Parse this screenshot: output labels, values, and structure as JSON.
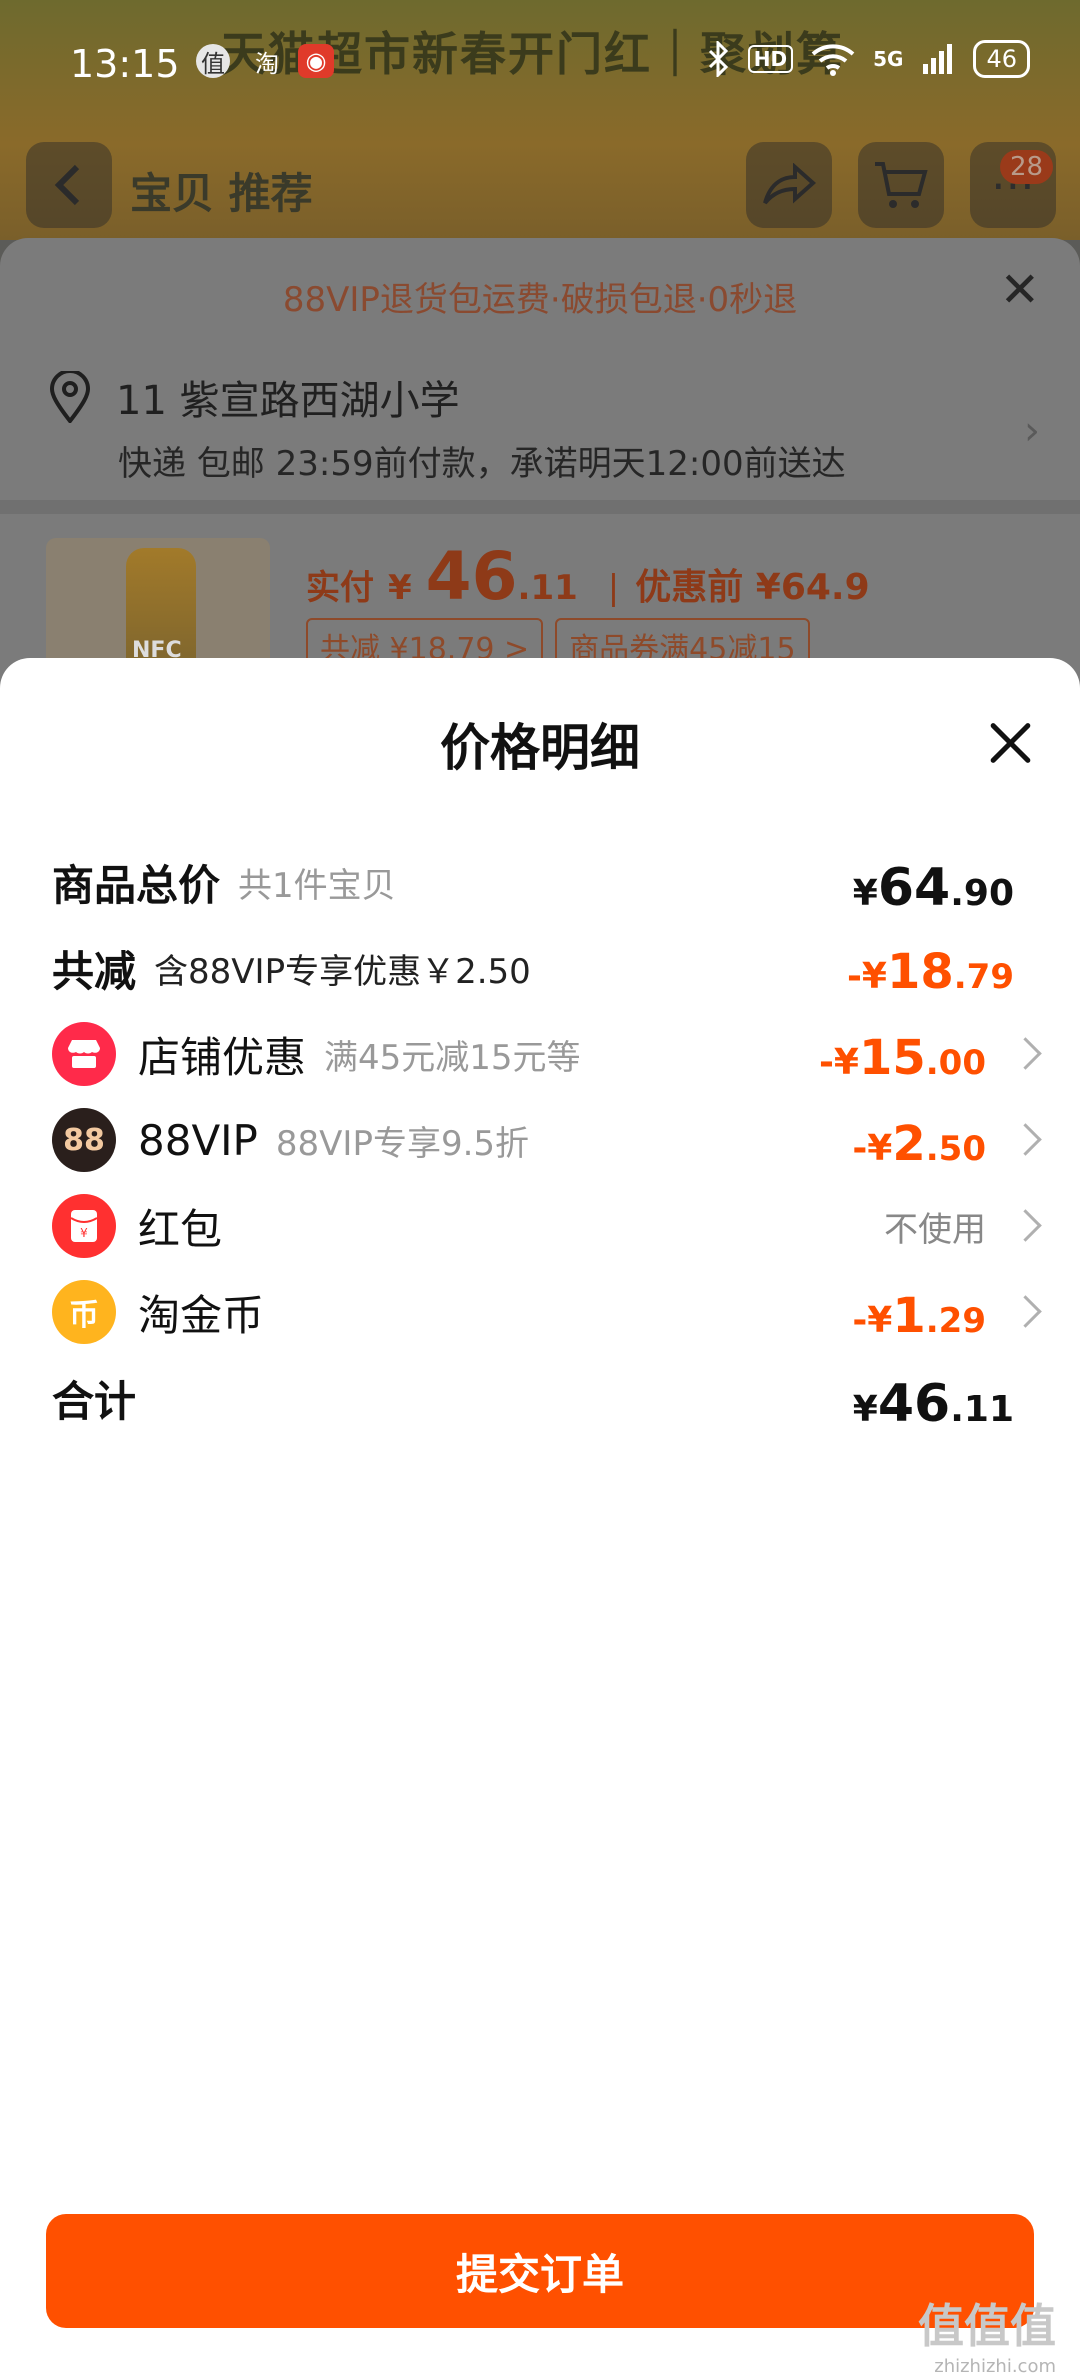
{
  "status_bar": {
    "time": "13:15",
    "app_icons": [
      "值",
      "淘"
    ],
    "network": "5G",
    "hd": "HD",
    "battery": "46"
  },
  "background_page": {
    "banner": "天猫超市新春开门红｜聚划算",
    "tabs": "宝贝  推荐",
    "cart_badge": "28",
    "promo": "88VIP退货包运费·破损包退·0秒退",
    "address": "11 紫宣路西湖小学",
    "delivery": "快递 包邮 23:59前付款，承诺明天12:00前送达",
    "product_label": "NFC",
    "price_label": "实付",
    "price_symbol": "¥",
    "price_int": "46",
    "price_dec": ".11",
    "orig_price": "优惠前 ¥64.9",
    "chip_total": "共减 ¥18.79 >",
    "chip_coupon": "商品券满45减15"
  },
  "sheet": {
    "title": "价格明细",
    "rows": {
      "total_goods": {
        "label": "商品总价",
        "sub": "共1件宝贝",
        "symbol": "¥",
        "int": "64",
        "dec": ".90"
      },
      "total_discount": {
        "label": "共减",
        "sub": "含88VIP专享优惠￥2.50",
        "symbol": "-¥",
        "int": "18",
        "dec": ".79"
      },
      "shop_discount": {
        "label": "店铺优惠",
        "sub": "满45元减15元等",
        "symbol": "-¥",
        "int": "15",
        "dec": ".00",
        "icon": "shop-icon"
      },
      "vip88": {
        "label": "88VIP",
        "sub": "88VIP专享9.5折",
        "icon_text": "88",
        "symbol": "-¥",
        "int": "2",
        "dec": ".50",
        "icon": "vip88-icon"
      },
      "red_packet": {
        "label": "红包",
        "value": "不使用",
        "icon": "red-packet-icon"
      },
      "tao_coin": {
        "label": "淘金币",
        "icon_text": "币",
        "symbol": "-¥",
        "int": "1",
        "dec": ".29",
        "icon": "coin-icon"
      },
      "sum": {
        "label": "合计",
        "symbol": "¥",
        "int": "46",
        "dec": ".11"
      }
    },
    "submit_label": "提交订单"
  },
  "watermark": {
    "main": "值值值",
    "sub": "zhizhizhi.com"
  },
  "colors": {
    "accent": "#ff5000",
    "text": "#111111",
    "muted": "#999999"
  }
}
